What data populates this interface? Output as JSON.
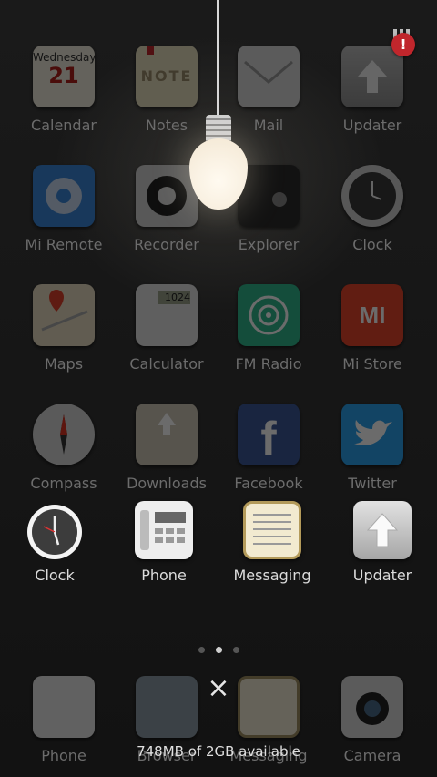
{
  "grid_rows": [
    [
      {
        "label": "Calendar",
        "icon": "calendar-icon",
        "day": "Wednesday",
        "date": "21"
      },
      {
        "label": "Notes",
        "icon": "notes-icon",
        "text": "NOTE"
      },
      {
        "label": "Mail",
        "icon": "mail-icon"
      },
      {
        "label": "Updater",
        "icon": "updater-icon"
      }
    ],
    [
      {
        "label": "Mi Remote",
        "icon": "mi-remote-icon"
      },
      {
        "label": "Recorder",
        "icon": "recorder-icon"
      },
      {
        "label": "Explorer",
        "icon": "explorer-icon"
      },
      {
        "label": "Clock",
        "icon": "clock-icon"
      }
    ],
    [
      {
        "label": "Maps",
        "icon": "maps-icon"
      },
      {
        "label": "Calculator",
        "icon": "calculator-icon",
        "display": "1024"
      },
      {
        "label": "FM Radio",
        "icon": "fm-radio-icon"
      },
      {
        "label": "Mi Store",
        "icon": "mi-store-icon",
        "logo": "MI"
      }
    ],
    [
      {
        "label": "Compass",
        "icon": "compass-icon"
      },
      {
        "label": "Downloads",
        "icon": "downloads-icon"
      },
      {
        "label": "Facebook",
        "icon": "facebook-icon",
        "logo": "f"
      },
      {
        "label": "Twitter",
        "icon": "twitter-icon"
      }
    ]
  ],
  "recent_apps": [
    {
      "label": "Clock",
      "icon": "clock-icon"
    },
    {
      "label": "Phone",
      "icon": "phone-icon"
    },
    {
      "label": "Messaging",
      "icon": "messaging-icon"
    },
    {
      "label": "Updater",
      "icon": "updater-icon"
    }
  ],
  "dock": [
    {
      "label": "Phone",
      "icon": "phone-icon"
    },
    {
      "label": "Browser",
      "icon": "browser-icon"
    },
    {
      "label": "Messaging",
      "icon": "messaging-icon"
    },
    {
      "label": "Camera",
      "icon": "camera-icon"
    }
  ],
  "badge": {
    "text": "!"
  },
  "page_indicator": {
    "count": 3,
    "active": 1
  },
  "close_symbol": "×",
  "memory_text": "748MB of 2GB available"
}
